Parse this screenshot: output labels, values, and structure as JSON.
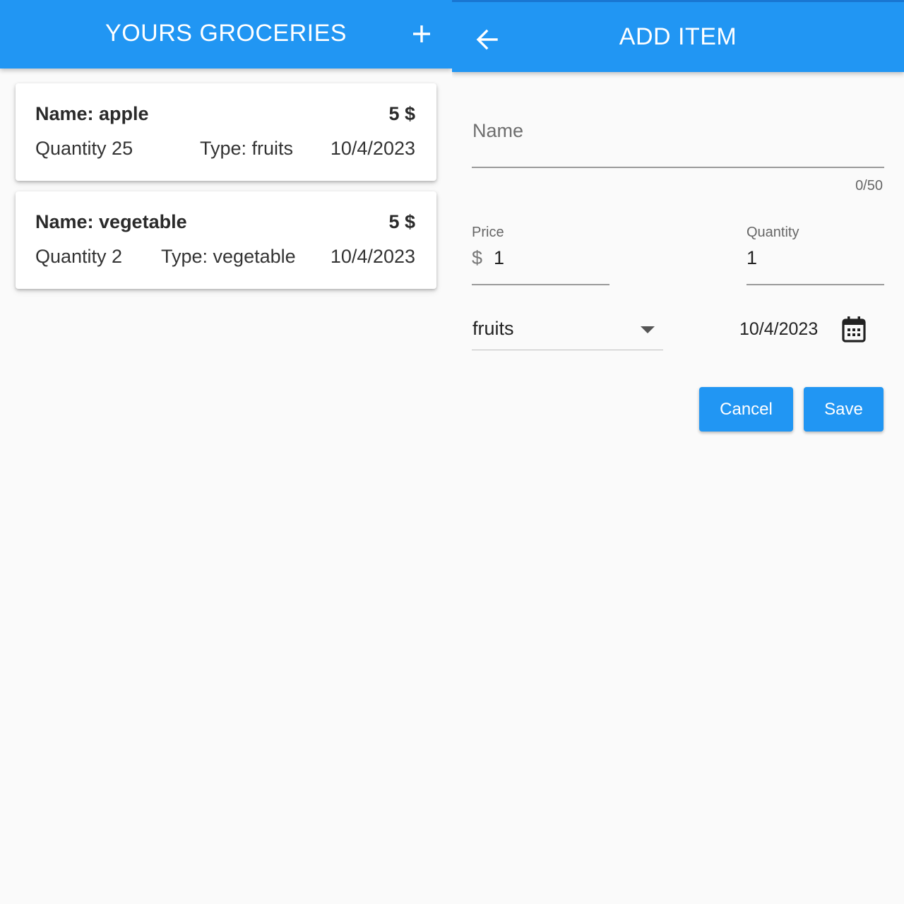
{
  "list_screen": {
    "title": "YOURS GROCERIES",
    "add_icon": "plus-icon",
    "items": [
      {
        "name_line": "Name: apple",
        "price": "5 $",
        "quantity": "Quantity 25",
        "type": "Type: fruits",
        "date": "10/4/2023"
      },
      {
        "name_line": "Name: vegetable",
        "price": "5 $",
        "quantity": "Quantity 2",
        "type": "Type: vegetable",
        "date": "10/4/2023"
      }
    ]
  },
  "add_screen": {
    "title": "ADD ITEM",
    "back_icon": "arrow-left-icon",
    "name_field": {
      "placeholder": "Name",
      "value": "",
      "counter": "0/50"
    },
    "price_field": {
      "label": "Price",
      "prefix": "$",
      "value": "1"
    },
    "quantity_field": {
      "label": "Quantity",
      "value": "1"
    },
    "type_dropdown": {
      "selected": "fruits"
    },
    "date": {
      "value": "10/4/2023",
      "icon": "calendar-icon"
    },
    "buttons": {
      "cancel": "Cancel",
      "save": "Save"
    }
  },
  "colors": {
    "primary": "#2196f3",
    "background": "#fafafa",
    "card": "#ffffff"
  }
}
